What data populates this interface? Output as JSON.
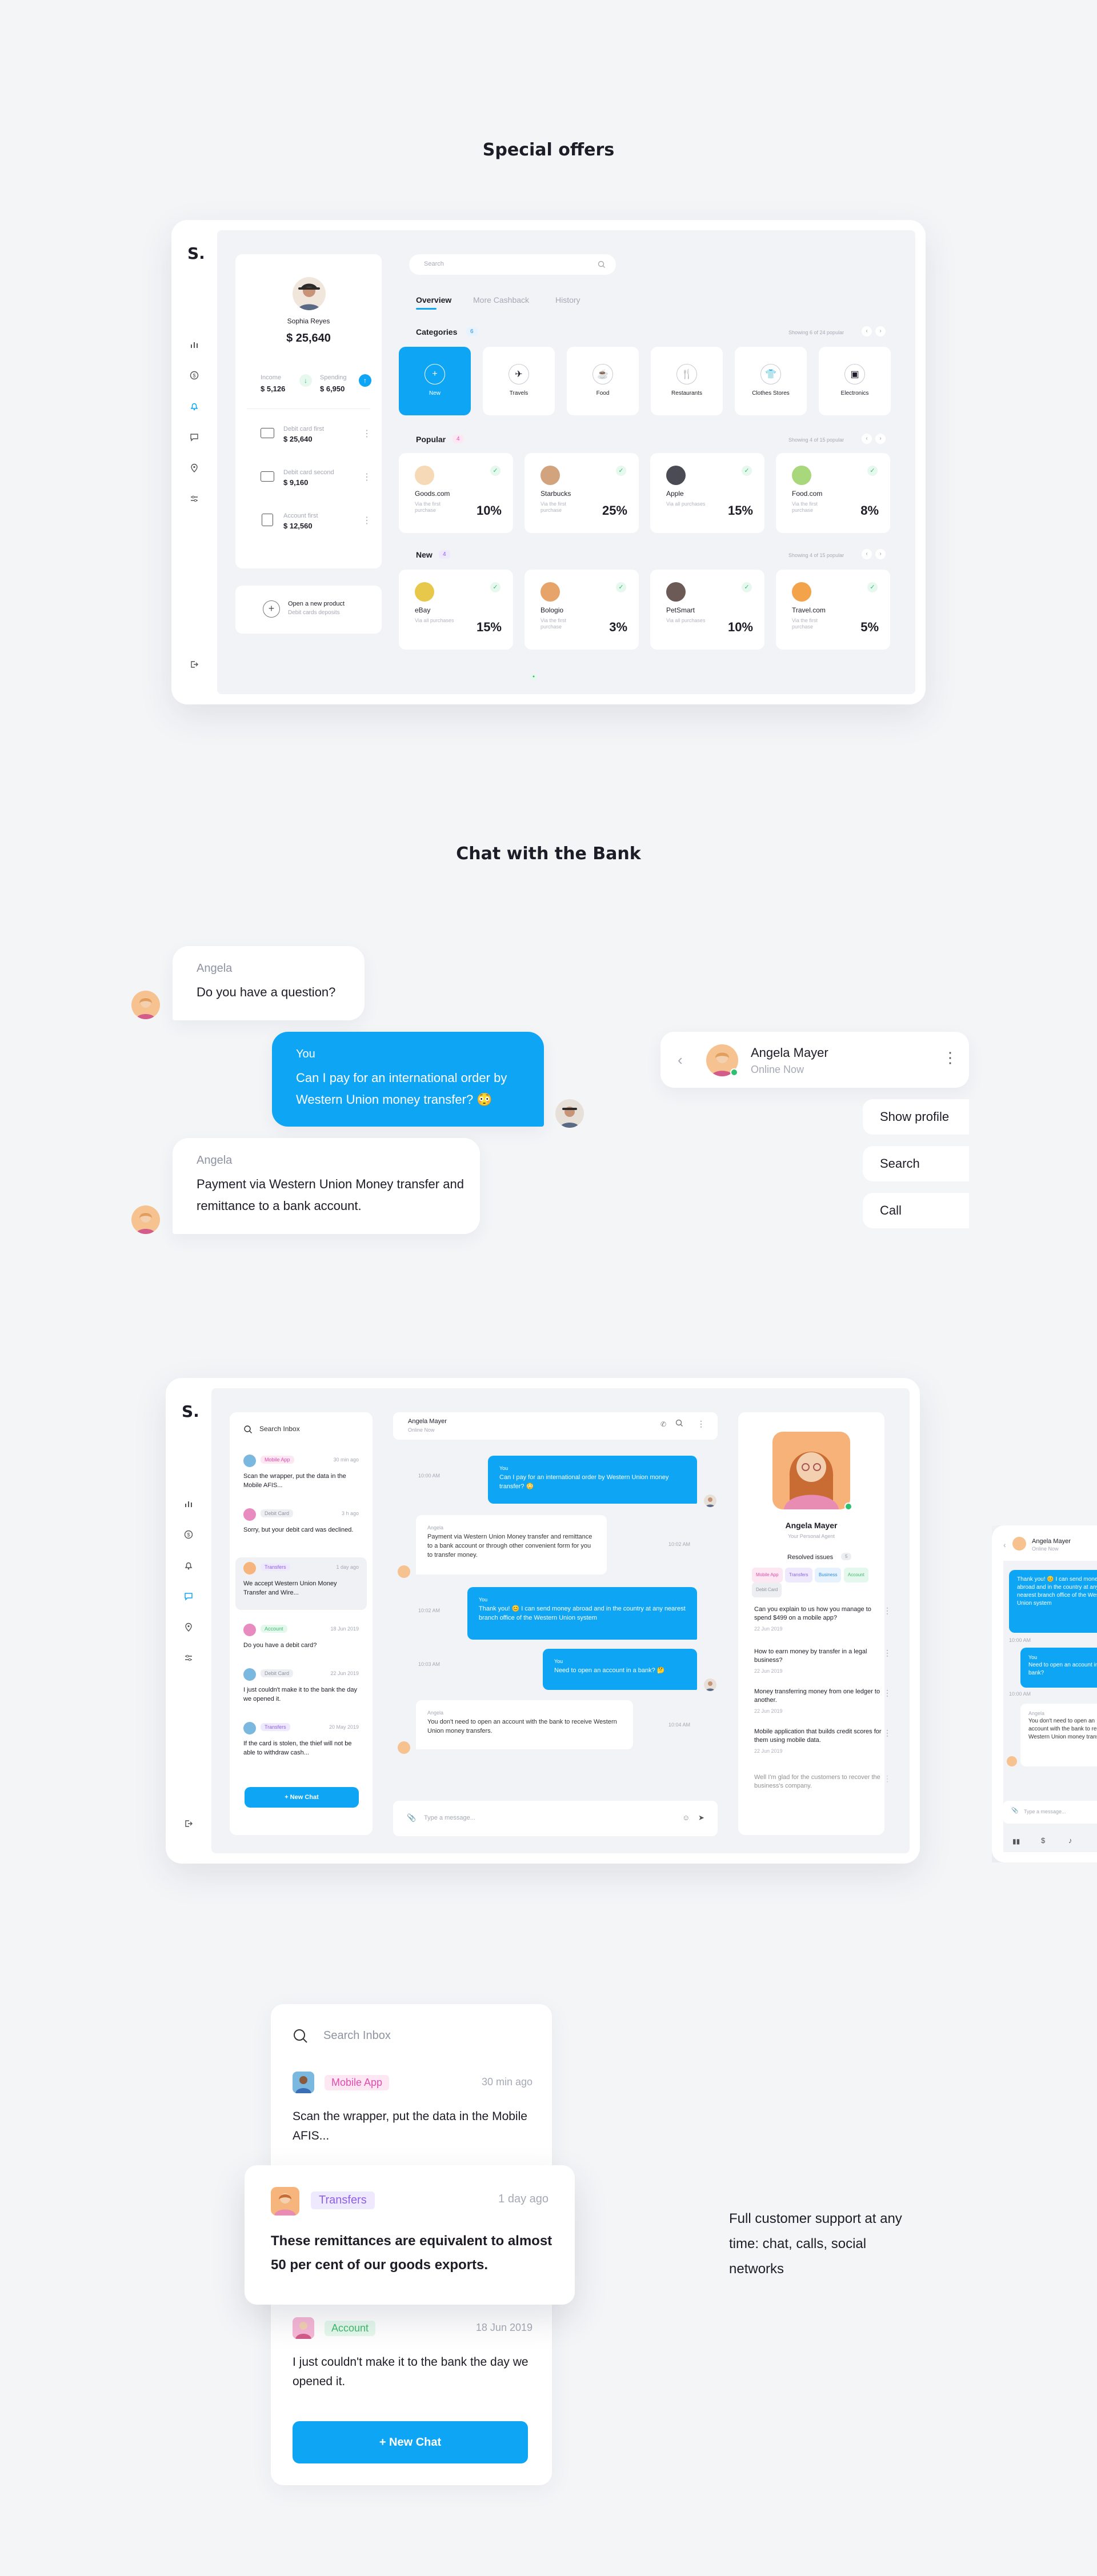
{
  "sections": {
    "offers_title": "Special offers",
    "chat_title": "Chat with the Bank"
  },
  "colors": {
    "accent": "#0ea5f5",
    "background": "#f4f5f7",
    "panel": "#f2f3f6"
  },
  "app": {
    "logo": "S.",
    "nav_icons": [
      "chart-icon",
      "dollar-icon",
      "bell-icon",
      "chat-icon",
      "location-icon",
      "sliders-icon"
    ],
    "logout_icon": "logout-icon"
  },
  "profile": {
    "name": "Sophia Reyes",
    "balance": "$ 25,640",
    "income_label": "Income",
    "income_value": "$ 5,126",
    "spending_label": "Spending",
    "spending_value": "$ 6,950",
    "accounts": [
      {
        "name": "Debit card first",
        "value": "$ 25,640"
      },
      {
        "name": "Debit card second",
        "value": "$ 9,160"
      },
      {
        "name": "Account first",
        "value": "$ 12,560"
      }
    ],
    "new_product_title": "Open a new product",
    "new_product_sub": "Debit cards deposits"
  },
  "offers": {
    "search_placeholder": "Search",
    "tabs": [
      "Overview",
      "More Cashback",
      "History"
    ],
    "categories_title": "Categories",
    "categories_badge": "6",
    "categories_showing": "Showing 6 of 24 popular",
    "categories": [
      "New",
      "Travels",
      "Food",
      "Restaurants",
      "Clothes Stores",
      "Electronics"
    ],
    "popular_title": "Popular",
    "popular_badge": "4",
    "popular_showing": "Showing 4 of 15 popular",
    "popular": [
      {
        "name": "Goods.com",
        "sub": "Via the first purchase",
        "pct": "10%"
      },
      {
        "name": "Starbucks",
        "sub": "Via the first purchase",
        "pct": "25%"
      },
      {
        "name": "Apple",
        "sub": "Via all purchases",
        "pct": "15%"
      },
      {
        "name": "Food.com",
        "sub": "Via the first purchase",
        "pct": "8%"
      }
    ],
    "new_title": "New",
    "new_badge": "4",
    "new_showing": "Showing 4 of 15 popular",
    "new": [
      {
        "name": "eBay",
        "sub": "Via all purchases",
        "pct": "15%"
      },
      {
        "name": "Bologio",
        "sub": "Via the first purchase",
        "pct": "3%"
      },
      {
        "name": "PetSmart",
        "sub": "Via all purchases",
        "pct": "10%"
      },
      {
        "name": "Travel.com",
        "sub": "Via the first purchase",
        "pct": "5%"
      }
    ]
  },
  "chat_demo": {
    "b1_who": "Angela",
    "b1_msg": "Do you have a question?",
    "b2_who": "You",
    "b2_msg": "Can I pay for an international order by Western Union money transfer? 😳",
    "b3_who": "Angela",
    "b3_msg": "Payment via Western Union Money transfer and remittance to a bank account.",
    "contact_name": "Angela Mayer",
    "contact_status": "Online Now",
    "menu": [
      "Show profile",
      "Search",
      "Call"
    ]
  },
  "chat_app": {
    "search_placeholder": "Search Inbox",
    "inbox": [
      {
        "tag": "Mobile App",
        "time": "30 min ago",
        "text": "Scan the wrapper, put the data in the Mobile AFIS..."
      },
      {
        "tag": "Debit Card",
        "time": "3 h ago",
        "text": "Sorry, but your debit card was declined."
      },
      {
        "tag": "Transfers",
        "time": "1 day ago",
        "text": "We accept Western Union Money Transfer and Wire..."
      },
      {
        "tag": "Account",
        "time": "18 Jun 2019",
        "text": "Do you have a debit card?"
      },
      {
        "tag": "Debit Card",
        "time": "22 Jun 2019",
        "text": "I just couldn't make it to the bank the day we opened it."
      },
      {
        "tag": "Transfers",
        "time": "20 May 2019",
        "text": "If the card is stolen, the thief will not be able to withdraw cash..."
      }
    ],
    "new_chat": "+ New Chat",
    "header_name": "Angela Mayer",
    "header_status": "Online Now",
    "messages": [
      {
        "from": "me",
        "who": "You",
        "text": "Can I pay for an international order by Western Union money transfer? 😳",
        "time": "10:00 AM"
      },
      {
        "from": "them",
        "who": "Angela",
        "text": "Payment via Western Union Money transfer and remittance to a bank account or through other convenient form for you to transfer money.",
        "time": "10:02 AM"
      },
      {
        "from": "me",
        "who": "You",
        "text": "Thank you! 😊 I can send money abroad and in the country at any nearest branch office of the Western Union system",
        "time": "10:02 AM"
      },
      {
        "from": "me",
        "who": "You",
        "text": "Need to open an account in a bank? 🤔",
        "time": "10:03 AM"
      },
      {
        "from": "them",
        "who": "Angela",
        "text": "You don't need to open an account with the bank to receive Western Union money transfers.",
        "time": "10:04 AM"
      }
    ],
    "composer_placeholder": "Type a message...",
    "agent_name": "Angela Mayer",
    "agent_role": "Your Personal Agent",
    "resolved_title": "Resolved issues",
    "resolved_count": "5",
    "resolved_tags": [
      "Mobile App",
      "Transfers",
      "Business",
      "Account",
      "Debit Card"
    ],
    "issues": [
      {
        "text": "Can you explain to us how you manage to spend $499 on a mobile app?",
        "date": "22 Jun 2019"
      },
      {
        "text": "How to earn money by transfer in a legal business?",
        "date": "22 Jun 2019"
      },
      {
        "text": "Money transferring money from one ledger to another.",
        "date": "22 Jun 2019"
      },
      {
        "text": "Mobile application that builds credit scores for them using mobile data.",
        "date": "22 Jun 2019"
      },
      {
        "text": "Well I'm glad for the customers to recover the business's company.",
        "date": ""
      }
    ]
  },
  "mobile_preview": {
    "name": "Angela Mayer",
    "status": "Online Now",
    "msg1": "Thank you! 😊 I can send money abroad and in the country at any nearest branch office of the Western Union system",
    "msg2": "Need to open an account in a bank?",
    "msg3_who": "Angela",
    "msg3": "You don't need to open an account with the bank to receive Western Union money transfers.",
    "composer": "Type a message..."
  },
  "inbox_zoom": {
    "search_placeholder": "Search Inbox",
    "item1_tag": "Mobile App",
    "item1_time": "30 min ago",
    "item1_text": "Scan the wrapper, put the data in the Mobile AFIS...",
    "item2_tag": "Transfers",
    "item2_time": "1 day ago",
    "item2_text": "These remittances are equivalent to almost 50 per cent of our goods exports.",
    "item3_tag": "Account",
    "item3_time": "18 Jun 2019",
    "item3_text": "I just couldn't make it to the bank the day we opened it.",
    "new_chat": "+ New Chat",
    "caption": "Full customer support at any time: chat, calls, social networks"
  }
}
